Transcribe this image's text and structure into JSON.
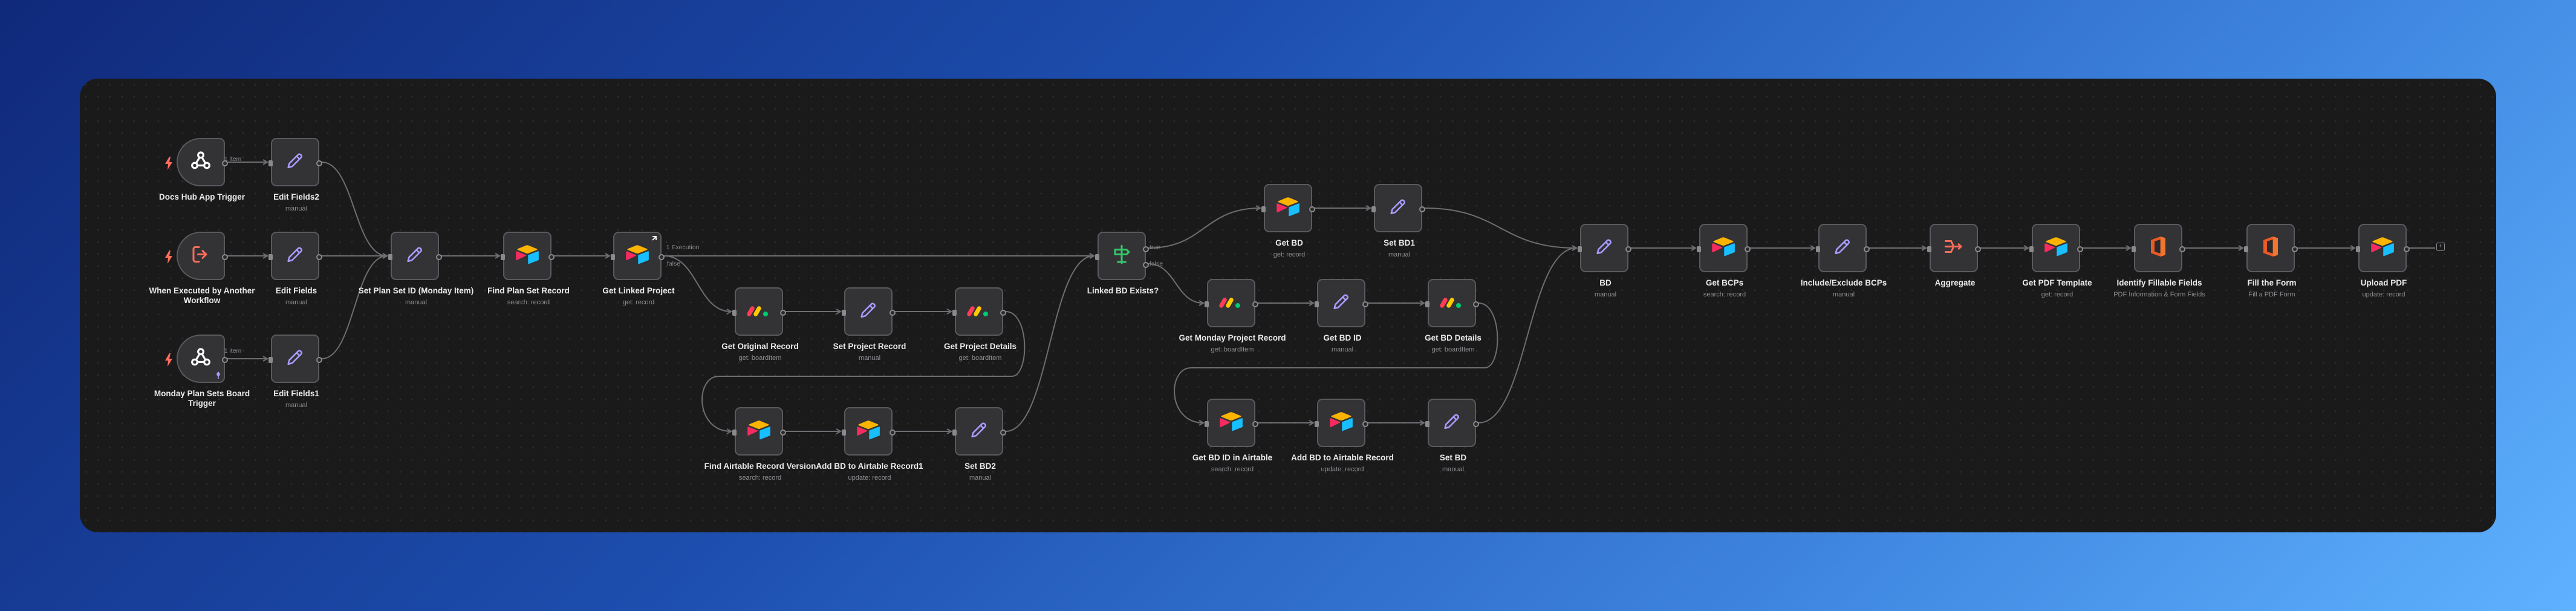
{
  "nodes": [
    {
      "id": "docs_hub_trigger",
      "title": "Docs Hub App Trigger",
      "subtitle": "",
      "icon": "webhook-icon",
      "trigger": true
    },
    {
      "id": "edit_fields2",
      "title": "Edit Fields2",
      "subtitle": "manual",
      "icon": "pencil-icon"
    },
    {
      "id": "when_executed",
      "title": "When Executed by Another Workflow",
      "subtitle": "",
      "icon": "exit-arrow-icon",
      "trigger": true
    },
    {
      "id": "edit_fields",
      "title": "Edit Fields",
      "subtitle": "manual",
      "icon": "pencil-icon"
    },
    {
      "id": "monday_trigger",
      "title": "Monday Plan Sets Board Trigger",
      "subtitle": "",
      "icon": "webhook-icon",
      "trigger": true
    },
    {
      "id": "edit_fields1",
      "title": "Edit Fields1",
      "subtitle": "manual",
      "icon": "pencil-icon"
    },
    {
      "id": "set_plan_set_id",
      "title": "Set Plan Set ID (Monday Item)",
      "subtitle": "manual",
      "icon": "pencil-icon"
    },
    {
      "id": "find_plan_set_record",
      "title": "Find Plan Set Record",
      "subtitle": "search: record",
      "icon": "airtable-icon"
    },
    {
      "id": "get_linked_project",
      "title": "Get Linked Project",
      "subtitle": "get: record",
      "icon": "airtable-icon"
    },
    {
      "id": "get_original_record",
      "title": "Get Original Record",
      "subtitle": "get: boardItem",
      "icon": "monday-icon"
    },
    {
      "id": "set_project_record",
      "title": "Set Project Record",
      "subtitle": "manual",
      "icon": "pencil-icon"
    },
    {
      "id": "get_project_details",
      "title": "Get Project Details",
      "subtitle": "get: boardItem",
      "icon": "monday-icon"
    },
    {
      "id": "find_airtable_record_version",
      "title": "Find Airtable Record Version",
      "subtitle": "search: record",
      "icon": "airtable-icon"
    },
    {
      "id": "add_bd_airtable_record1",
      "title": "Add BD to Airtable Record1",
      "subtitle": "update: record",
      "icon": "airtable-icon"
    },
    {
      "id": "set_bd2",
      "title": "Set BD2",
      "subtitle": "manual",
      "icon": "pencil-icon"
    },
    {
      "id": "linked_bd_exists",
      "title": "Linked BD Exists?",
      "subtitle": "",
      "icon": "signpost-icon"
    },
    {
      "id": "get_bd",
      "title": "Get BD",
      "subtitle": "get: record",
      "icon": "airtable-icon"
    },
    {
      "id": "set_bd1",
      "title": "Set BD1",
      "subtitle": "manual",
      "icon": "pencil-icon"
    },
    {
      "id": "get_monday_project_record",
      "title": "Get Monday Project Record",
      "subtitle": "get: boardItem",
      "icon": "monday-icon"
    },
    {
      "id": "get_bd_id",
      "title": "Get BD ID",
      "subtitle": "manual",
      "icon": "pencil-icon"
    },
    {
      "id": "get_bd_details",
      "title": "Get BD Details",
      "subtitle": "get: boardItem",
      "icon": "monday-icon"
    },
    {
      "id": "get_bd_id_airtable",
      "title": "Get BD ID in Airtable",
      "subtitle": "search: record",
      "icon": "airtable-icon"
    },
    {
      "id": "add_bd_airtable_record",
      "title": "Add BD to Airtable Record",
      "subtitle": "update: record",
      "icon": "airtable-icon"
    },
    {
      "id": "set_bd",
      "title": "Set BD",
      "subtitle": "manual",
      "icon": "pencil-icon"
    },
    {
      "id": "bd",
      "title": "BD",
      "subtitle": "manual",
      "icon": "pencil-icon"
    },
    {
      "id": "get_bcps",
      "title": "Get BCPs",
      "subtitle": "search: record",
      "icon": "airtable-icon"
    },
    {
      "id": "include_exclude_bcps",
      "title": "Include/Exclude BCPs",
      "subtitle": "manual",
      "icon": "pencil-icon"
    },
    {
      "id": "aggregate",
      "title": "Aggregate",
      "subtitle": "",
      "icon": "aggregate-icon"
    },
    {
      "id": "get_pdf_template",
      "title": "Get PDF Template",
      "subtitle": "get: record",
      "icon": "airtable-icon"
    },
    {
      "id": "identify_fillable_fields",
      "title": "Identify Fillable Fields",
      "subtitle": "PDF Information & Form Fields",
      "icon": "office-icon"
    },
    {
      "id": "fill_the_form",
      "title": "Fill the Form",
      "subtitle": "Fill a PDF Form",
      "icon": "office-icon"
    },
    {
      "id": "upload_pdf",
      "title": "Upload PDF",
      "subtitle": "update: record",
      "icon": "airtable-icon"
    }
  ],
  "edge_labels": {
    "docs_hub_items": "1 item",
    "monday_items": "1 item",
    "linked_project_branch": "1 Execution",
    "linked_project_false": "false",
    "if_true": "true",
    "if_false": "false"
  },
  "colors": {
    "canvas": "#1a1a1b",
    "node": "#333336",
    "edge": "#6e6e72",
    "pencil": "#a99cff",
    "trigger_red": "#ff6d5a"
  }
}
